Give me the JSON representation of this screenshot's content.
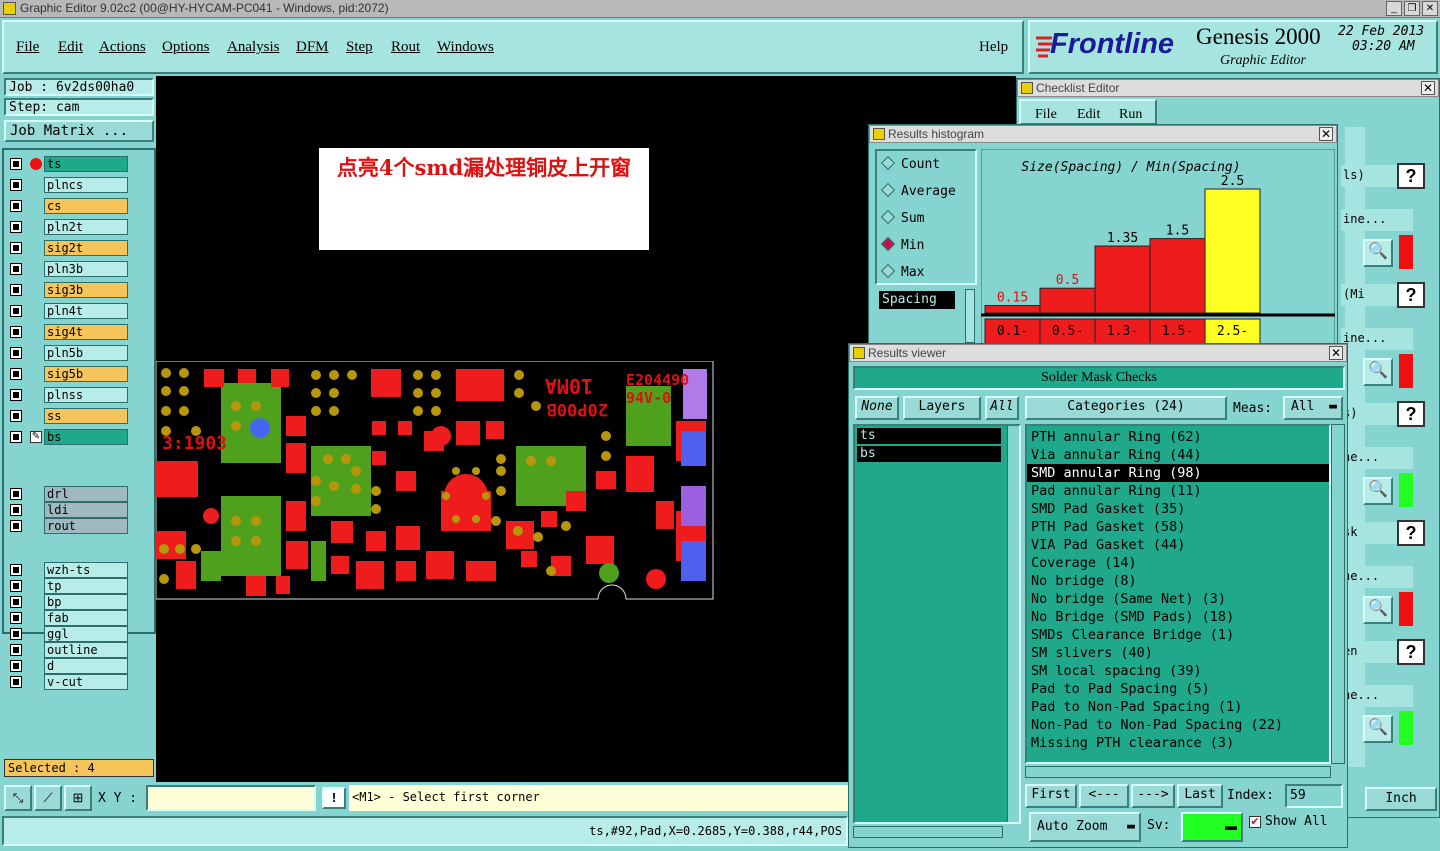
{
  "window": {
    "title": "Graphic Editor 9.02c2 (00@HY-HYCAM-PC041 - Windows, pid:2072)",
    "buttons": [
      "_",
      "❐",
      "✕"
    ]
  },
  "menu": {
    "items": [
      "File",
      "Edit",
      "Actions",
      "Options",
      "Analysis",
      "DFM",
      "Step",
      "Rout",
      "Windows"
    ],
    "help": "Help"
  },
  "logo": {
    "brand": "Frontline",
    "product": "Genesis 2000",
    "subtitle": "Graphic Editor",
    "date": "22 Feb 2013",
    "time": "03:20 AM"
  },
  "job": {
    "job_label": "Job  :  6v2ds00ha0",
    "step_label": "Step:  cam",
    "matrix_button": "Job Matrix ..."
  },
  "layers": [
    {
      "name": "ts",
      "color": "#1fa88a"
    },
    {
      "name": "plncs",
      "color": "#b8ece8"
    },
    {
      "name": "cs",
      "color": "#f5c45a"
    },
    {
      "name": "pln2t",
      "color": "#b8ece8"
    },
    {
      "name": "sig2t",
      "color": "#f5c45a"
    },
    {
      "name": "pln3b",
      "color": "#b8ece8"
    },
    {
      "name": "sig3b",
      "color": "#f5c45a"
    },
    {
      "name": "pln4t",
      "color": "#b8ece8"
    },
    {
      "name": "sig4t",
      "color": "#f5c45a"
    },
    {
      "name": "pln5b",
      "color": "#b8ece8"
    },
    {
      "name": "sig5b",
      "color": "#f5c45a"
    },
    {
      "name": "plnss",
      "color": "#b8ece8"
    },
    {
      "name": "ss",
      "color": "#f5c45a"
    },
    {
      "name": "bs",
      "color": "#1fa88a"
    },
    {
      "name": "drl",
      "color": "#a0b8c0"
    },
    {
      "name": "ldi",
      "color": "#a0b8c0"
    },
    {
      "name": "rout",
      "color": "#a0b8c0"
    },
    {
      "name": "wzh-ts",
      "color": "#b8ece8"
    },
    {
      "name": "tp",
      "color": "#b8ece8"
    },
    {
      "name": "bp",
      "color": "#b8ece8"
    },
    {
      "name": "fab",
      "color": "#b8ece8"
    },
    {
      "name": "ggl",
      "color": "#b8ece8"
    },
    {
      "name": "outline",
      "color": "#b8ece8"
    },
    {
      "name": "d",
      "color": "#b8ece8"
    },
    {
      "name": "v-cut",
      "color": "#b8ece8"
    }
  ],
  "selected": "Selected : 4",
  "annotation": "点亮4个smd漏处理铜皮上开窗",
  "board": {
    "text_lines": [
      "10MA",
      "E204490",
      "94V-0",
      "20P00B",
      "3:1903"
    ]
  },
  "coords": {
    "label": "X Y :",
    "value": "",
    "warn": "!",
    "prompt": "<M1> - Select first corner"
  },
  "status": "ts,#92,Pad,X=0.2685,Y=0.388,r44,POS",
  "checklist": {
    "title": "Checklist Editor",
    "menu": [
      "File",
      "Edit",
      "Run"
    ],
    "side_labels": [
      "ls)",
      "ine...",
      "(Mi",
      "ine...",
      "s)",
      "ne...",
      "sk",
      "ne...",
      "en",
      "ne..."
    ],
    "unit": "Inch"
  },
  "histogram": {
    "title": "Results histogram",
    "options": [
      {
        "label": "Count",
        "on": false
      },
      {
        "label": "Average",
        "on": false
      },
      {
        "label": "Sum",
        "on": false
      },
      {
        "label": "Min",
        "on": true
      },
      {
        "label": "Max",
        "on": false
      }
    ],
    "measure": "Spacing"
  },
  "chart_data": {
    "type": "bar",
    "title": "Size(Spacing) / Min(Spacing)",
    "categories": [
      "0.1-",
      "0.5-",
      "1.3-",
      "1.5-",
      "2.5-"
    ],
    "values": [
      0.15,
      0.5,
      1.35,
      1.5,
      2.5
    ],
    "value_labels": [
      "0.15",
      "0.5",
      "1.35",
      "1.5",
      "2.5"
    ],
    "colors": [
      "#ee1c1c",
      "#ee1c1c",
      "#ee1c1c",
      "#ee1c1c",
      "#ffff22"
    ],
    "ylim": [
      0,
      2.5
    ]
  },
  "results": {
    "title": "Results viewer",
    "heading": "Solder Mask Checks",
    "none": "None",
    "layers": "Layers",
    "all": "All",
    "categories_label": "Categories (24)",
    "meas_label": "Meas:",
    "meas_value": "All",
    "layer_list": [
      "ts",
      "bs"
    ],
    "categories": [
      "PTH annular Ring (62)",
      "Via annular Ring (44)",
      "SMD annular Ring (98)",
      "Pad annular Ring (11)",
      "SMD Pad Gasket (35)",
      "PTH Pad Gasket (58)",
      "VIA Pad Gasket (44)",
      "Coverage (14)",
      "No bridge (8)",
      "No bridge (Same Net) (3)",
      "No Bridge (SMD Pads) (18)",
      "SMDs Clearance Bridge (1)",
      "SM slivers (40)",
      "SM local spacing (39)",
      "Pad to Pad Spacing (5)",
      "Pad to Non-Pad Spacing (1)",
      "Non-Pad to Non-Pad Spacing (22)",
      "Missing PTH clearance (3)"
    ],
    "selected_index": 2,
    "nav": {
      "first": "First",
      "prev": "<---",
      "next": "--->",
      "last": "Last",
      "index_label": "Index:",
      "index_value": "59"
    },
    "zoom": "Auto Zoom",
    "sv": "Sv:",
    "show_all": "Show All"
  }
}
